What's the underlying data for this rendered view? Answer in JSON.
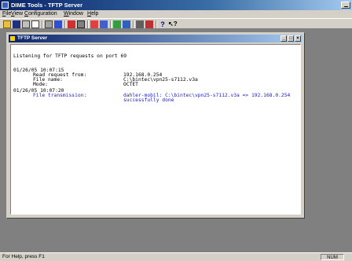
{
  "window": {
    "title": "DIME Tools - TFTP Server"
  },
  "menu": [
    "File",
    "View",
    "Configuration",
    "Window",
    "Help"
  ],
  "toolbar": {
    "icons": [
      "open-icon",
      "save-icon",
      "print-icon",
      "print-preview-icon",
      "tool-icon",
      "wrench-icon",
      "network-icon",
      "card-icon",
      "tftp-icon",
      "config-icon",
      "connect-icon",
      "disconnect-icon",
      "monitor-icon",
      "trace-icon",
      "about-icon",
      "context-help-icon"
    ]
  },
  "child_window": {
    "title": "TFTP Server",
    "log": {
      "listening": "Listening for TFTP requests on port 69",
      "entry1_time": "01/26/05 10:07:15",
      "entry1_read_label": "Read request from:",
      "entry1_read_value": "192.168.0.254",
      "entry1_file_label": "File name:",
      "entry1_file_value": "C:\\bintec\\vpn25-s7112.v3a",
      "entry1_mode_label": "Mode:",
      "entry1_mode_value": "OCTET",
      "entry2_time": "01/26/05 10:07:20",
      "entry2_label": "File transmission:",
      "entry2_value": "dahler-mobil: C:\\bintec\\vpn25-s7112.v3a => 192.168.0.254",
      "entry2_status": "successfully done"
    }
  },
  "status": {
    "help": "For Help, press F1",
    "num": "NUM"
  },
  "colors": {
    "log_blue": "#1a1acc",
    "title_active": "#0a246a",
    "mdi_bg": "#808080"
  }
}
